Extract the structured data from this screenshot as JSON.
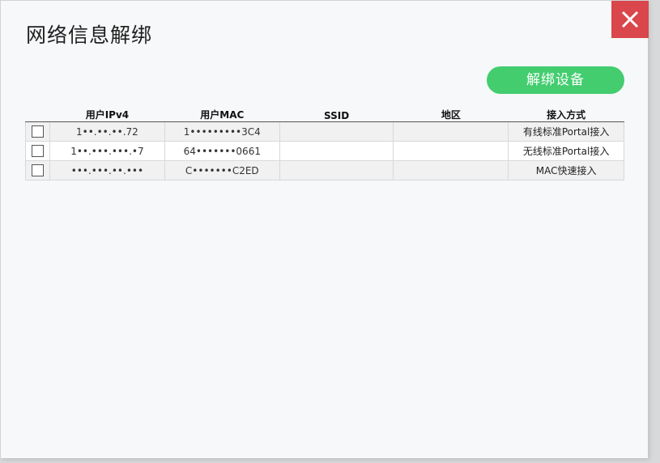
{
  "dialog": {
    "title": "网络信息解绑",
    "close_icon": "close-icon",
    "unbind_button_label": "解绑设备",
    "accent_color": "#43cd6f",
    "close_color": "#d9464b"
  },
  "table": {
    "headers": {
      "ip": "用户IPv4",
      "mac": "用户MAC",
      "ssid": "SSID",
      "region": "地区",
      "method": "接入方式"
    },
    "rows": [
      {
        "ip": "1••.••.••.72",
        "mac": "1•••••••••3C4",
        "ssid": "",
        "region": "",
        "method": "有线标准Portal接入"
      },
      {
        "ip": "1••.•••.•••.•7",
        "mac": "64•••••••0661",
        "ssid": "",
        "region": "",
        "method": "无线标准Portal接入"
      },
      {
        "ip": "•••.•••.••.•••",
        "mac": "C•••••••C2ED",
        "ssid": "",
        "region": "",
        "method": "MAC快速接入"
      }
    ]
  }
}
